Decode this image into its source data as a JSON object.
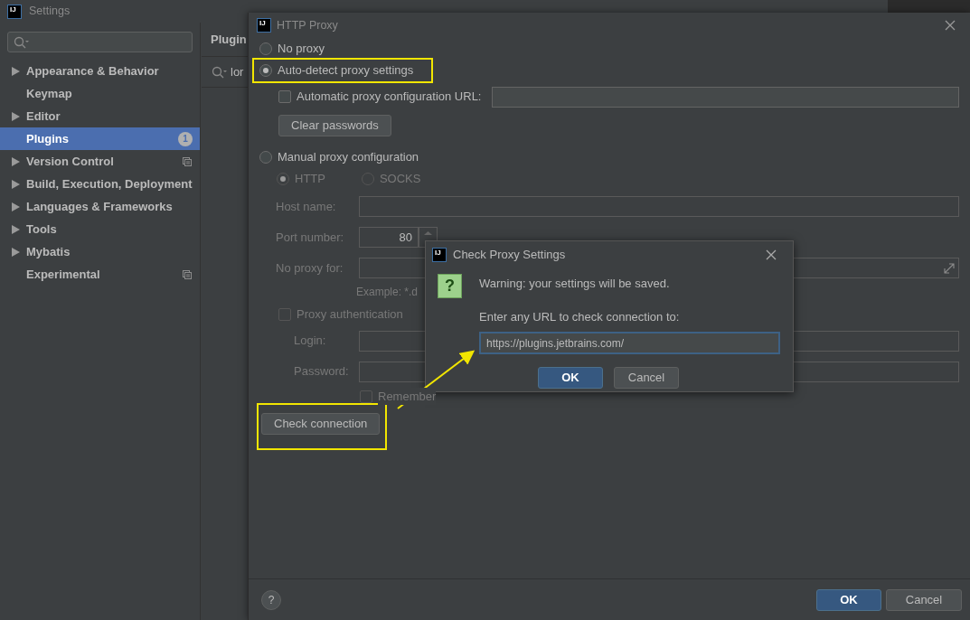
{
  "settings_window": {
    "logo": "IJ",
    "title": "Settings",
    "sidebar": {
      "items": [
        {
          "label": "Appearance & Behavior",
          "expandable": true,
          "selected": false,
          "project_icon": false
        },
        {
          "label": "Keymap",
          "expandable": false,
          "selected": false,
          "project_icon": false
        },
        {
          "label": "Editor",
          "expandable": true,
          "selected": false,
          "project_icon": false
        },
        {
          "label": "Plugins",
          "expandable": false,
          "selected": true,
          "project_icon": false,
          "badge": "1"
        },
        {
          "label": "Version Control",
          "expandable": true,
          "selected": false,
          "project_icon": true
        },
        {
          "label": "Build, Execution, Deployment",
          "expandable": true,
          "selected": false,
          "project_icon": false
        },
        {
          "label": "Languages & Frameworks",
          "expandable": true,
          "selected": false,
          "project_icon": false
        },
        {
          "label": "Tools",
          "expandable": true,
          "selected": false,
          "project_icon": false
        },
        {
          "label": "Mybatis",
          "expandable": true,
          "selected": false,
          "project_icon": false
        },
        {
          "label": "Experimental",
          "expandable": false,
          "selected": false,
          "project_icon": true
        }
      ]
    },
    "content": {
      "title": "Plugin",
      "search_value": "lor"
    }
  },
  "http_proxy_dialog": {
    "logo": "IJ",
    "title": "HTTP Proxy",
    "modes": [
      {
        "label": "No proxy",
        "selected": false,
        "highlighted": false
      },
      {
        "label": "Auto-detect proxy settings",
        "selected": true,
        "highlighted": true
      }
    ],
    "auto_url": {
      "label": "Automatic proxy configuration URL:",
      "checked": false
    },
    "clear_button": "Clear passwords",
    "manual": {
      "label": "Manual proxy configuration",
      "selected": false,
      "disabled": true,
      "protocols": [
        {
          "label": "HTTP",
          "selected": true
        },
        {
          "label": "SOCKS",
          "selected": false
        }
      ],
      "fields": [
        {
          "label": "Host name:",
          "kind": "text"
        },
        {
          "label": "Port number:",
          "kind": "spinner",
          "value": "80"
        },
        {
          "label": "No proxy for:",
          "kind": "expandable"
        }
      ],
      "example": "Example: *.d",
      "auth": {
        "label": "Proxy authentication",
        "checked": false
      },
      "auth_fields": [
        {
          "label": "Login:"
        },
        {
          "label": "Password:"
        }
      ],
      "remember": {
        "label": "Remember",
        "checked": false
      }
    },
    "check_button": {
      "label": "Check connection",
      "highlighted": true
    },
    "help_glyph": "?",
    "buttons": [
      {
        "label": "OK",
        "kind": "primary"
      },
      {
        "label": "Cancel",
        "kind": "secondary"
      }
    ]
  },
  "check_dialog": {
    "logo": "IJ",
    "title": "Check Proxy Settings",
    "icon_glyph": "?",
    "message": "Warning: your settings will be saved.",
    "prompt": "Enter any URL to check connection to:",
    "url_value": "https://plugins.jetbrains.com/",
    "buttons": [
      {
        "label": "OK",
        "kind": "primary"
      },
      {
        "label": "Cancel",
        "kind": "secondary"
      }
    ]
  }
}
